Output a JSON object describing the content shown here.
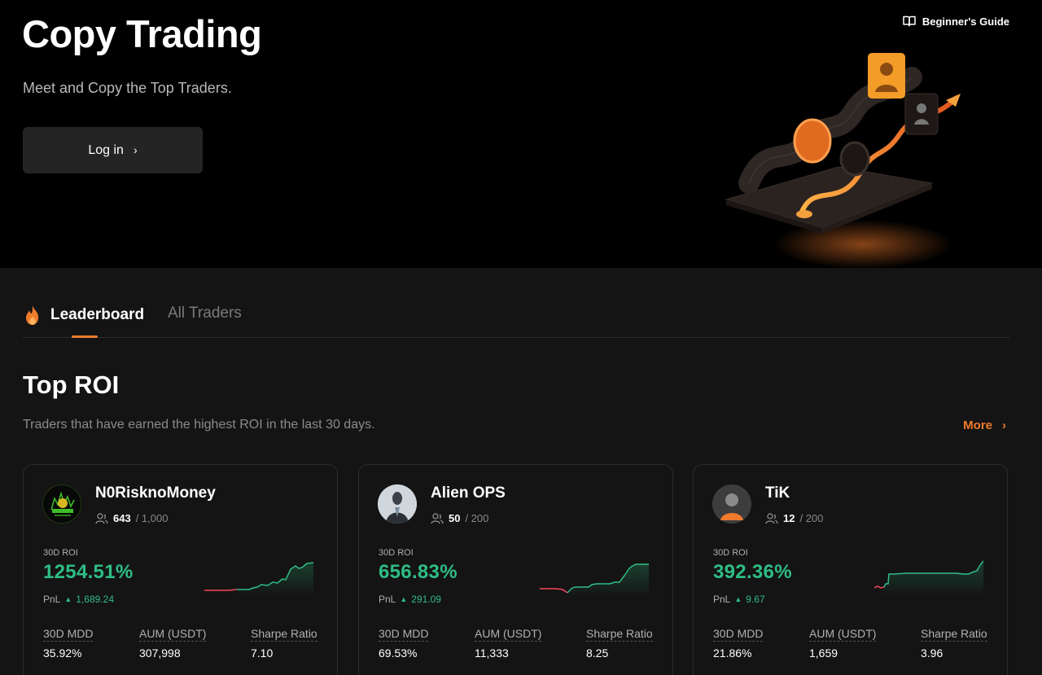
{
  "hero": {
    "title": "Copy Trading",
    "subtitle": "Meet and Copy the Top Traders.",
    "login_label": "Log in",
    "login_chevron": "›",
    "guide_label": "Beginner's Guide",
    "accent": "#f07b2c"
  },
  "tabs": [
    {
      "label": "Leaderboard",
      "active": true,
      "icon": "fire-icon"
    },
    {
      "label": "All Traders",
      "active": false
    }
  ],
  "section": {
    "title": "Top ROI",
    "description": "Traders that have earned the highest ROI in the last 30 days.",
    "more_label": "More",
    "more_chevron": "›"
  },
  "traders": [
    {
      "name": "N0RisknoMoney",
      "followers": "643",
      "followers_max": "/ 1,000",
      "roi_label": "30D ROI",
      "roi": "1254.51%",
      "pnl_label": "PnL",
      "pnl": "1,689.24",
      "mdd_label": "30D MDD",
      "mdd": "35.92%",
      "aum_label": "AUM (USDT)",
      "aum": "307,998",
      "sharpe_label": "Sharpe Ratio",
      "sharpe": "7.10",
      "avatar_text": "N0RisknoMoney"
    },
    {
      "name": "Alien OPS",
      "followers": "50",
      "followers_max": "/ 200",
      "roi_label": "30D ROI",
      "roi": "656.83%",
      "pnl_label": "PnL",
      "pnl": "291.09",
      "mdd_label": "30D MDD",
      "mdd": "69.53%",
      "aum_label": "AUM (USDT)",
      "aum": "11,333",
      "sharpe_label": "Sharpe Ratio",
      "sharpe": "8.25"
    },
    {
      "name": "TiK",
      "followers": "12",
      "followers_max": "/ 200",
      "roi_label": "30D ROI",
      "roi": "392.36%",
      "pnl_label": "PnL",
      "pnl": "9.67",
      "mdd_label": "30D MDD",
      "mdd": "21.86%",
      "aum_label": "AUM (USDT)",
      "aum": "1,659",
      "sharpe_label": "Sharpe Ratio",
      "sharpe": "3.96"
    }
  ],
  "colors": {
    "positive": "#2ebd85",
    "negative": "#f6465d",
    "accent": "#f07b2c",
    "card_bg": "#141414",
    "hero_bg": "#000000"
  }
}
